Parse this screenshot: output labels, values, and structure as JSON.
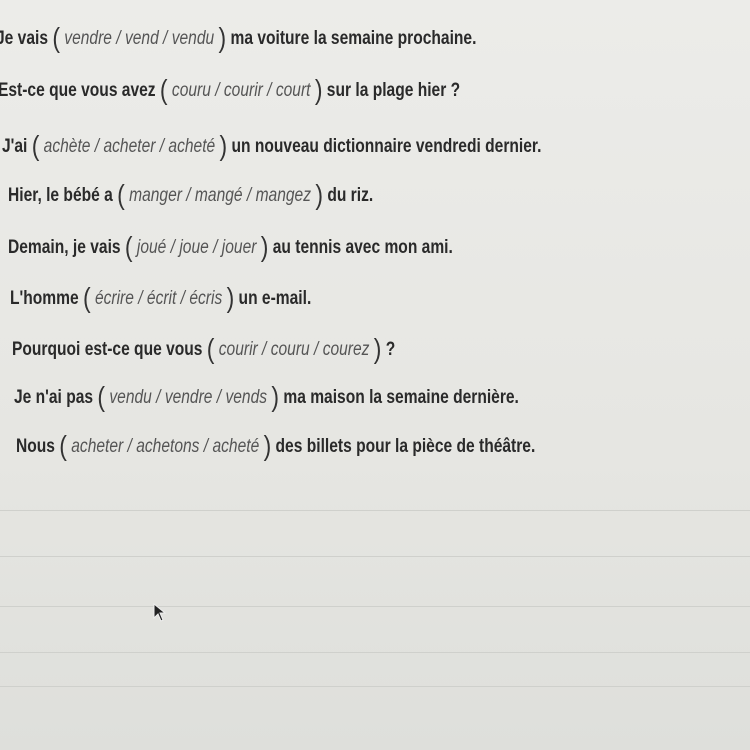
{
  "exercise": {
    "sentences": [
      {
        "prefix": "Je vais",
        "options": [
          "vendre",
          "vend",
          "vendu"
        ],
        "suffix": "ma voiture la semaine prochaine."
      },
      {
        "prefix": "Est-ce que vous avez",
        "options": [
          "couru",
          "courir",
          "court"
        ],
        "suffix": "sur la plage hier ?"
      },
      {
        "prefix": "J'ai",
        "options": [
          "achète",
          "acheter",
          "acheté"
        ],
        "suffix": "un nouveau dictionnaire vendredi dernier."
      },
      {
        "prefix": "Hier, le bébé a",
        "options": [
          "manger",
          "mangé",
          "mangez"
        ],
        "suffix": "du riz."
      },
      {
        "prefix": "Demain, je vais",
        "options": [
          "joué",
          "joue",
          "jouer"
        ],
        "suffix": "au tennis avec mon ami."
      },
      {
        "prefix": "L'homme",
        "options": [
          "écrire",
          "écrit",
          "écris"
        ],
        "suffix": "un e-mail."
      },
      {
        "prefix": "Pourquoi est-ce que vous",
        "options": [
          "courir",
          "couru",
          "courez"
        ],
        "suffix": "?"
      },
      {
        "prefix": "Je n'ai pas",
        "options": [
          "vendu",
          "vendre",
          "vends"
        ],
        "suffix": "ma maison la semaine dernière."
      },
      {
        "prefix": "Nous",
        "options": [
          "acheter",
          "achetons",
          "acheté"
        ],
        "suffix": "des billets pour la pièce de théâtre."
      }
    ],
    "open_paren": "(",
    "close_paren": ")",
    "separator": " / "
  },
  "cursor_icon": "mouse-pointer-icon"
}
